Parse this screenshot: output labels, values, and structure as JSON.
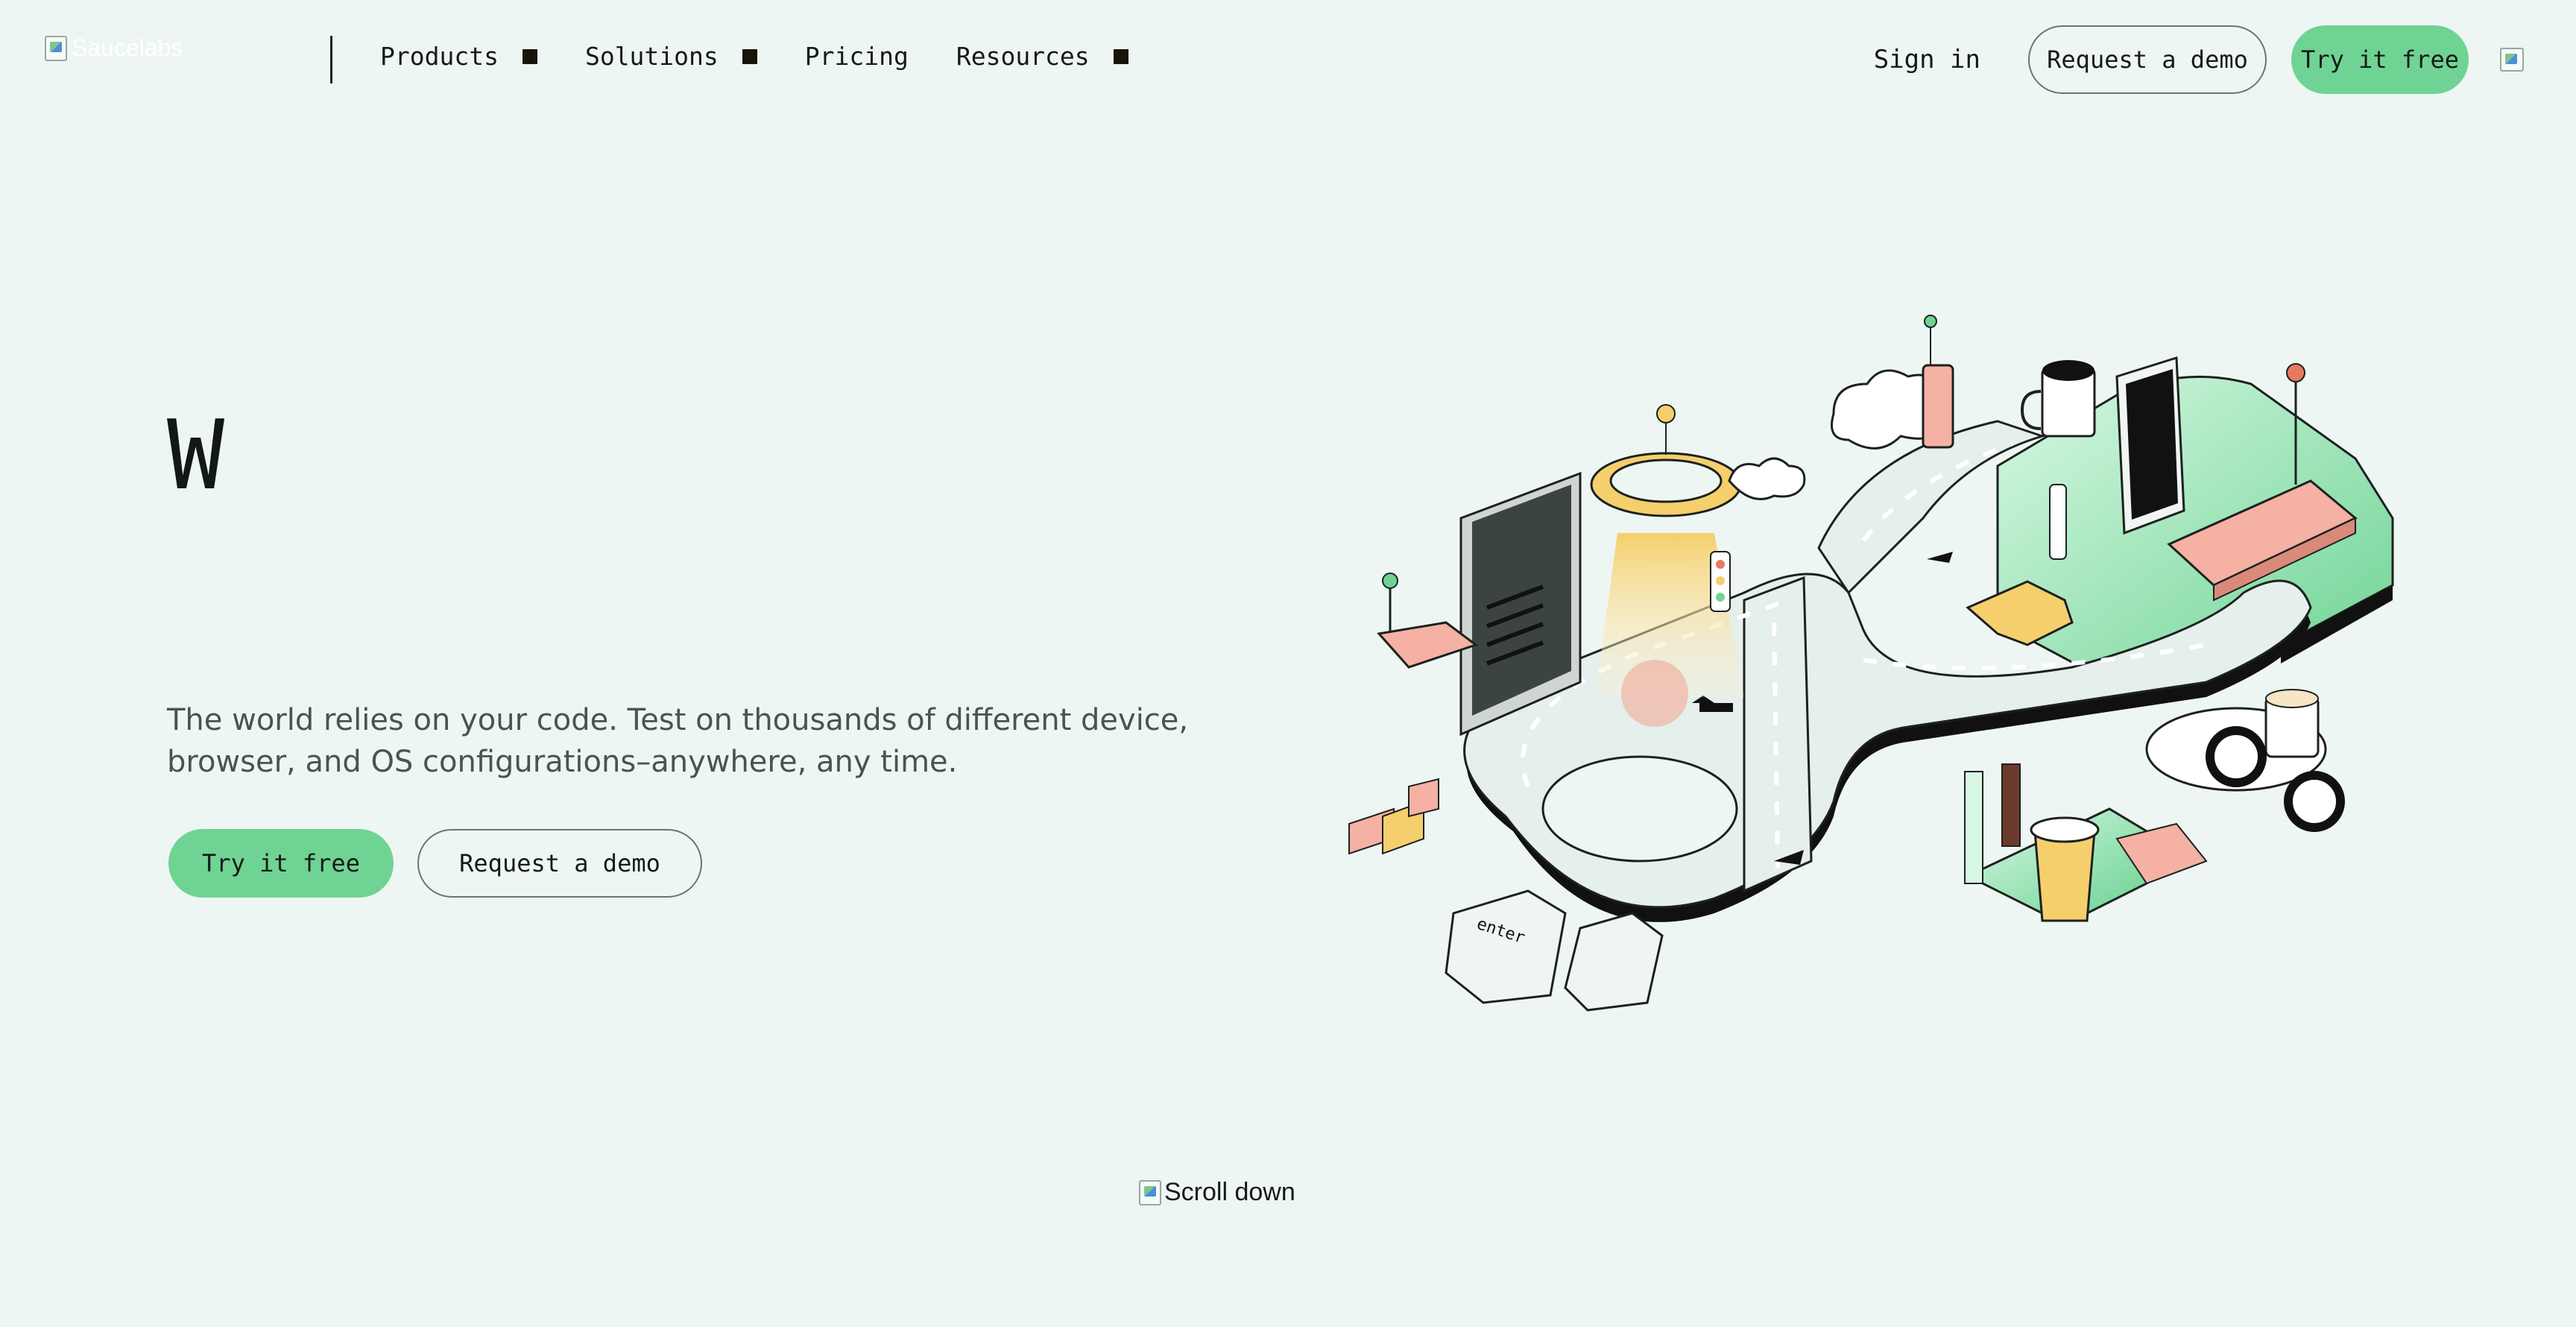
{
  "header": {
    "logo_alt": "Saucelabs",
    "nav": [
      {
        "label": "Products",
        "has_menu": true
      },
      {
        "label": "Solutions",
        "has_menu": true
      },
      {
        "label": "Pricing",
        "has_menu": false
      },
      {
        "label": "Resources",
        "has_menu": true
      }
    ],
    "sign_in": "Sign in",
    "request_demo": "Request a demo",
    "try_free": "Try it free"
  },
  "hero": {
    "heading": "W",
    "subtitle": "The world relies on your code. Test on thousands of different device, browser, and OS configurations–anywhere, any time.",
    "try_free": "Try it free",
    "request_demo": "Request a demo"
  },
  "scroll": {
    "label": "Scroll down"
  },
  "colors": {
    "background": "#eef6f3",
    "accent_green": "#6fd393",
    "text_dark": "#151a18"
  }
}
